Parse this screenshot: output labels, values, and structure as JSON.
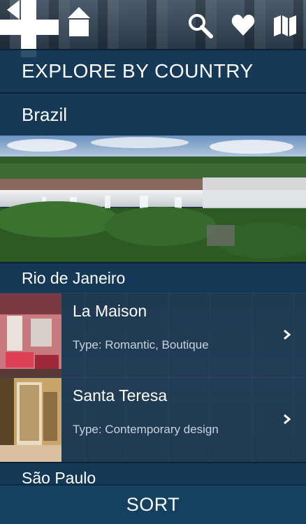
{
  "header": {
    "icons": {
      "back": "back-arrow-icon",
      "plus": "plus-icon",
      "home": "home-icon",
      "search": "search-icon",
      "favorites": "heart-icon",
      "map": "map-icon"
    }
  },
  "title": "EXPLORE BY COUNTRY",
  "country": "Brazil",
  "cities": [
    {
      "name": "Rio de Janeiro",
      "hotels": [
        {
          "name": "La Maison",
          "type": "Type: Romantic, Boutique"
        },
        {
          "name": "Santa Teresa",
          "type": "Type: Contemporary design"
        }
      ]
    },
    {
      "name": "São Paulo"
    }
  ],
  "sort_label": "SORT",
  "colors": {
    "band": "#123856",
    "sort_bar": "#16405f",
    "text": "#ffffff",
    "subtext": "#c9d3dc"
  }
}
